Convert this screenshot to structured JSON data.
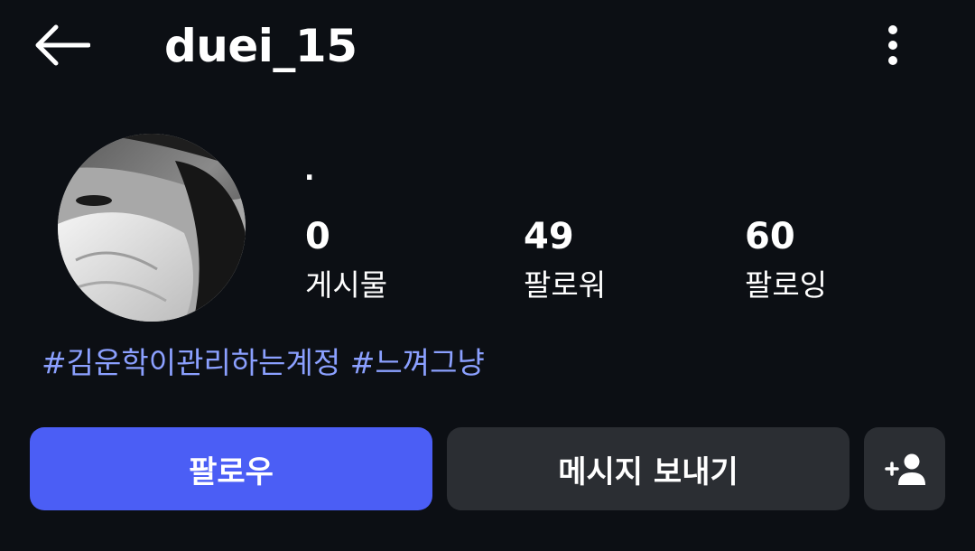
{
  "header": {
    "username": "duei_15",
    "back_icon": "arrow-left-icon",
    "more_icon": "more-vertical-icon"
  },
  "profile": {
    "bio_name": ".",
    "stats": {
      "posts": {
        "value": "0",
        "label": "게시물"
      },
      "followers": {
        "value": "49",
        "label": "팔로워"
      },
      "following": {
        "value": "60",
        "label": "팔로잉"
      }
    },
    "hashtags": [
      "#김운학이관리하는계정",
      "#느껴그냥"
    ]
  },
  "actions": {
    "follow_label": "팔로우",
    "message_label": "메시지 보내기",
    "add_icon": "add-person-icon"
  },
  "colors": {
    "background": "#0c0f14",
    "accent": "#4b5ef5",
    "hashtag": "#8ba0ff",
    "secondary_button": "#2b2e33"
  }
}
